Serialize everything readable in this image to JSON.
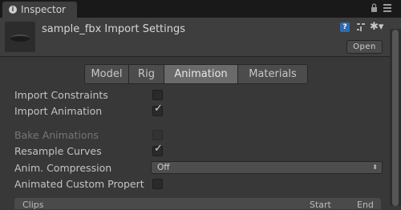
{
  "window": {
    "tab_title": "Inspector",
    "tab_icon": "info-icon"
  },
  "header": {
    "title": "sample_fbx Import Settings",
    "open_label": "Open",
    "icons": [
      "help-icon",
      "preset-icon",
      "gear-icon"
    ]
  },
  "tabs": [
    {
      "label": "Model",
      "active": false
    },
    {
      "label": "Rig",
      "active": false
    },
    {
      "label": "Animation",
      "active": true
    },
    {
      "label": "Materials",
      "active": false
    }
  ],
  "properties": [
    {
      "label": "Import Constraints",
      "type": "checkbox",
      "checked": false,
      "disabled": false
    },
    {
      "label": "Import Animation",
      "type": "checkbox",
      "checked": true,
      "disabled": false
    },
    {
      "label": "Bake Animations",
      "type": "checkbox",
      "checked": false,
      "disabled": true
    },
    {
      "label": "Resample Curves",
      "type": "checkbox",
      "checked": true,
      "disabled": false
    },
    {
      "label": "Anim. Compression",
      "type": "dropdown",
      "value": "Off"
    },
    {
      "label": "Animated Custom Propert",
      "type": "checkbox",
      "checked": false,
      "disabled": false
    }
  ],
  "clips": {
    "title": "Clips",
    "col_start": "Start",
    "col_end": "End"
  },
  "colors": {
    "background": "#383838",
    "header": "#3e3e3e",
    "active_tab": "#6a6a6a",
    "help_icon": "#2f6bb5"
  }
}
